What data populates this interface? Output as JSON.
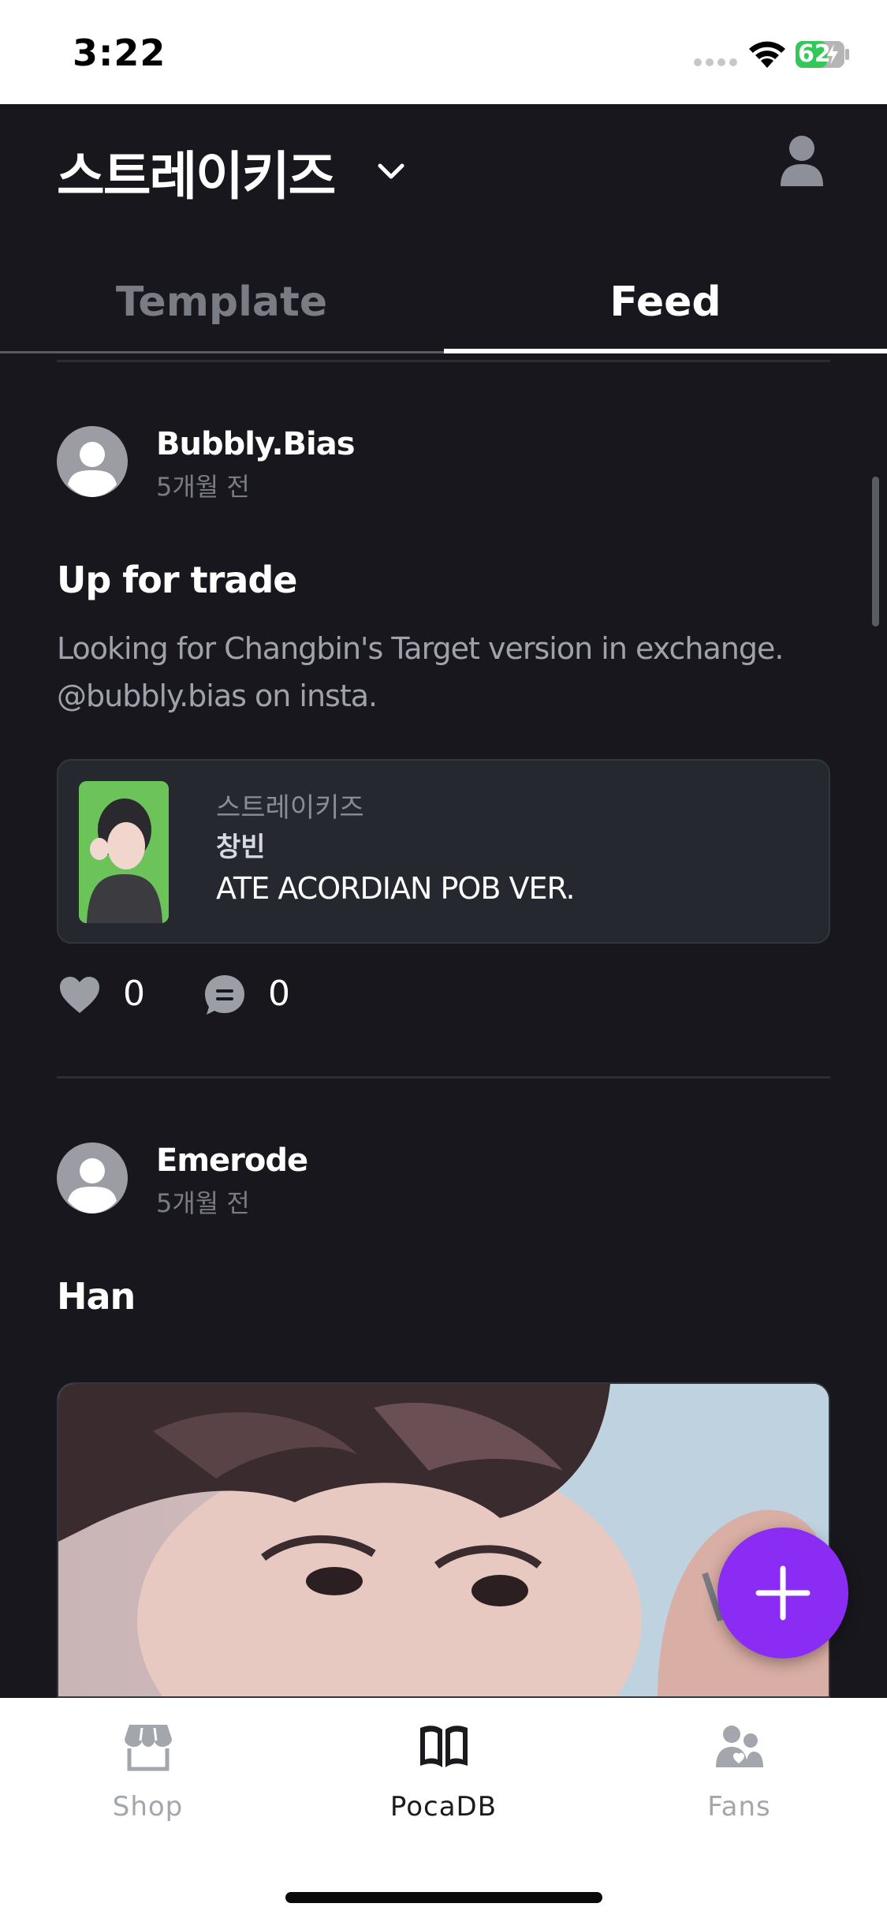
{
  "status_bar": {
    "time": "3:22",
    "battery": "62"
  },
  "header": {
    "group_name": "스트레이키즈"
  },
  "tabs": [
    {
      "label": "Template",
      "active": false
    },
    {
      "label": "Feed",
      "active": true
    }
  ],
  "posts": [
    {
      "author": "Bubbly.Bias",
      "time_ago": "5개월 전",
      "title": "Up for trade",
      "body": "Looking for Changbin's Target version in exchange. @bubbly.bias on insta.",
      "card": {
        "group": "스트레이키즈",
        "member": "창빈",
        "name": "ATE ACORDIAN POB VER."
      },
      "likes": "0",
      "comments": "0"
    },
    {
      "author": "Emerode",
      "time_ago": "5개월 전",
      "title": "Han"
    }
  ],
  "bottom_nav": [
    {
      "label": "Shop",
      "icon": "shop-icon",
      "active": false
    },
    {
      "label": "PocaDB",
      "icon": "book-icon",
      "active": true
    },
    {
      "label": "Fans",
      "icon": "fans-icon",
      "active": false
    }
  ],
  "colors": {
    "accent": "#8b2cf5",
    "background": "#18171d",
    "card": "#262830"
  }
}
